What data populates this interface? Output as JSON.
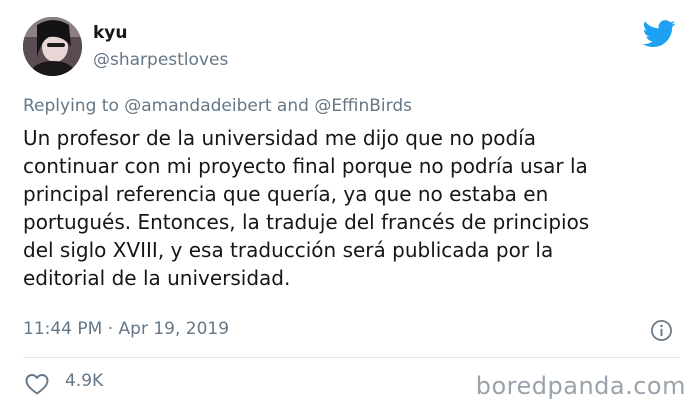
{
  "author": {
    "name": "kyu",
    "handle": "@sharpestloves"
  },
  "reply": {
    "prefix": "Replying to",
    "mention1": "@amandadeibert",
    "joiner": "and",
    "mention2": "@EffinBirds"
  },
  "tweet": {
    "text": "Un profesor de la universidad me dijo que no podía\ncontinuar con mi proyecto final porque no podría usar la\nprincipal referencia que quería, ya que no estaba en\nportugués. Entonces, la traduje del francés de principios\ndel siglo XVIII, y esa traducción será publicada por la\neditorial de la universidad.",
    "time": "11:44 PM",
    "separator": "·",
    "date": "Apr 19, 2019"
  },
  "actions": {
    "like_count": "4.9K"
  },
  "watermark": "boredpanda.com",
  "icons": {
    "brand": "twitter-bird-icon",
    "info": "info-icon",
    "like": "heart-icon"
  },
  "colors": {
    "twitter_blue": "#1da1f2",
    "secondary_text": "#657786",
    "primary_text": "#14171a"
  }
}
